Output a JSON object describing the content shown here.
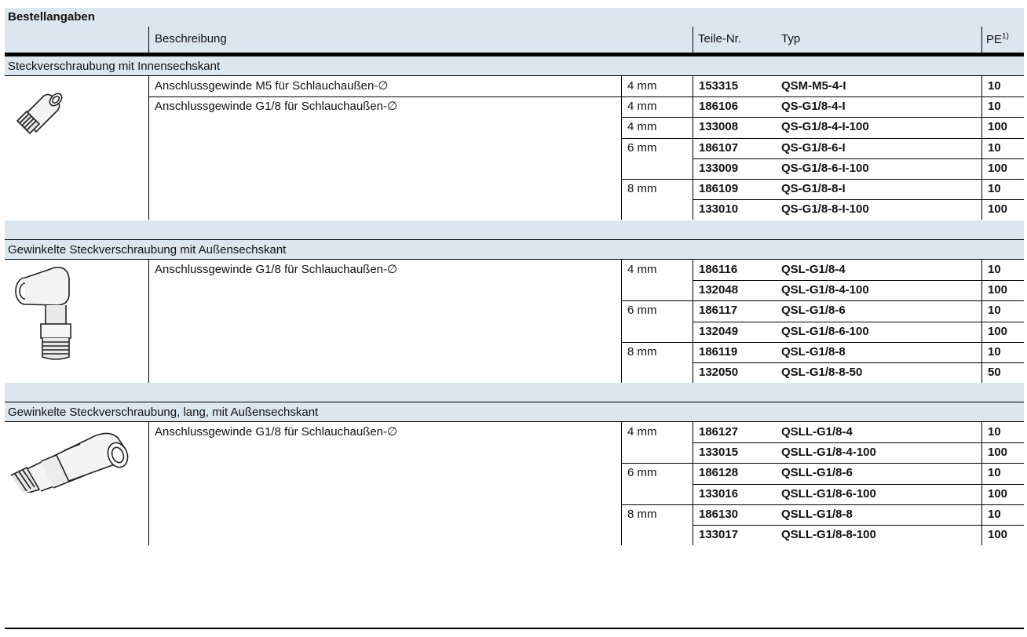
{
  "title": "Bestellangaben",
  "headers": {
    "beschreibung": "Beschreibung",
    "teile_nr": "Teile-Nr.",
    "typ": "Typ",
    "pe": "PE",
    "pe_sup": "1)"
  },
  "sections": [
    {
      "title": "Steckverschraubung mit Innensechskant",
      "image_icon": "straight-fitting-image",
      "descriptions": [
        "Anschlussgewinde M5 für Schlauchaußen-∅",
        "Anschlussgewinde G1/8 für Schlauchaußen-∅"
      ],
      "rows": [
        {
          "size": "4 mm",
          "part": "153315",
          "type": "QSM-M5-4-I",
          "pe": "10"
        },
        {
          "size": "4 mm",
          "part": "186106",
          "type": "QS-G1/8-4-I",
          "pe": "10"
        },
        {
          "size": "4 mm",
          "part": "133008",
          "type": "QS-G1/8-4-I-100",
          "pe": "100"
        },
        {
          "size": "6 mm",
          "part": "186107",
          "type": "QS-G1/8-6-I",
          "pe": "10"
        },
        {
          "size": "",
          "part": "133009",
          "type": "QS-G1/8-6-I-100",
          "pe": "100"
        },
        {
          "size": "8 mm",
          "part": "186109",
          "type": "QS-G1/8-8-I",
          "pe": "10"
        },
        {
          "size": "",
          "part": "133010",
          "type": "QS-G1/8-8-I-100",
          "pe": "100"
        }
      ]
    },
    {
      "title": "Gewinkelte Steckverschraubung mit Außensechskant",
      "image_icon": "angled-fitting-image",
      "descriptions": [
        "Anschlussgewinde G1/8 für Schlauchaußen-∅"
      ],
      "rows": [
        {
          "size": "4 mm",
          "part": "186116",
          "type": "QSL-G1/8-4",
          "pe": "10"
        },
        {
          "size": "",
          "part": "132048",
          "type": "QSL-G1/8-4-100",
          "pe": "100"
        },
        {
          "size": "6 mm",
          "part": "186117",
          "type": "QSL-G1/8-6",
          "pe": "10"
        },
        {
          "size": "",
          "part": "132049",
          "type": "QSL-G1/8-6-100",
          "pe": "100"
        },
        {
          "size": "8 mm",
          "part": "186119",
          "type": "QSL-G1/8-8",
          "pe": "10"
        },
        {
          "size": "",
          "part": "132050",
          "type": "QSL-G1/8-8-50",
          "pe": "50"
        }
      ]
    },
    {
      "title": "Gewinkelte Steckverschraubung, lang, mit Außensechskant",
      "image_icon": "long-angled-fitting-image",
      "descriptions": [
        "Anschlussgewinde G1/8 für Schlauchaußen-∅"
      ],
      "rows": [
        {
          "size": "4 mm",
          "part": "186127",
          "type": "QSLL-G1/8-4",
          "pe": "10"
        },
        {
          "size": "",
          "part": "133015",
          "type": "QSLL-G1/8-4-100",
          "pe": "100"
        },
        {
          "size": "6 mm",
          "part": "186128",
          "type": "QSLL-G1/8-6",
          "pe": "10"
        },
        {
          "size": "",
          "part": "133016",
          "type": "QSLL-G1/8-6-100",
          "pe": "100"
        },
        {
          "size": "8 mm",
          "part": "186130",
          "type": "QSLL-G1/8-8",
          "pe": "10"
        },
        {
          "size": "",
          "part": "133017",
          "type": "QSLL-G1/8-8-100",
          "pe": "100"
        }
      ]
    }
  ]
}
